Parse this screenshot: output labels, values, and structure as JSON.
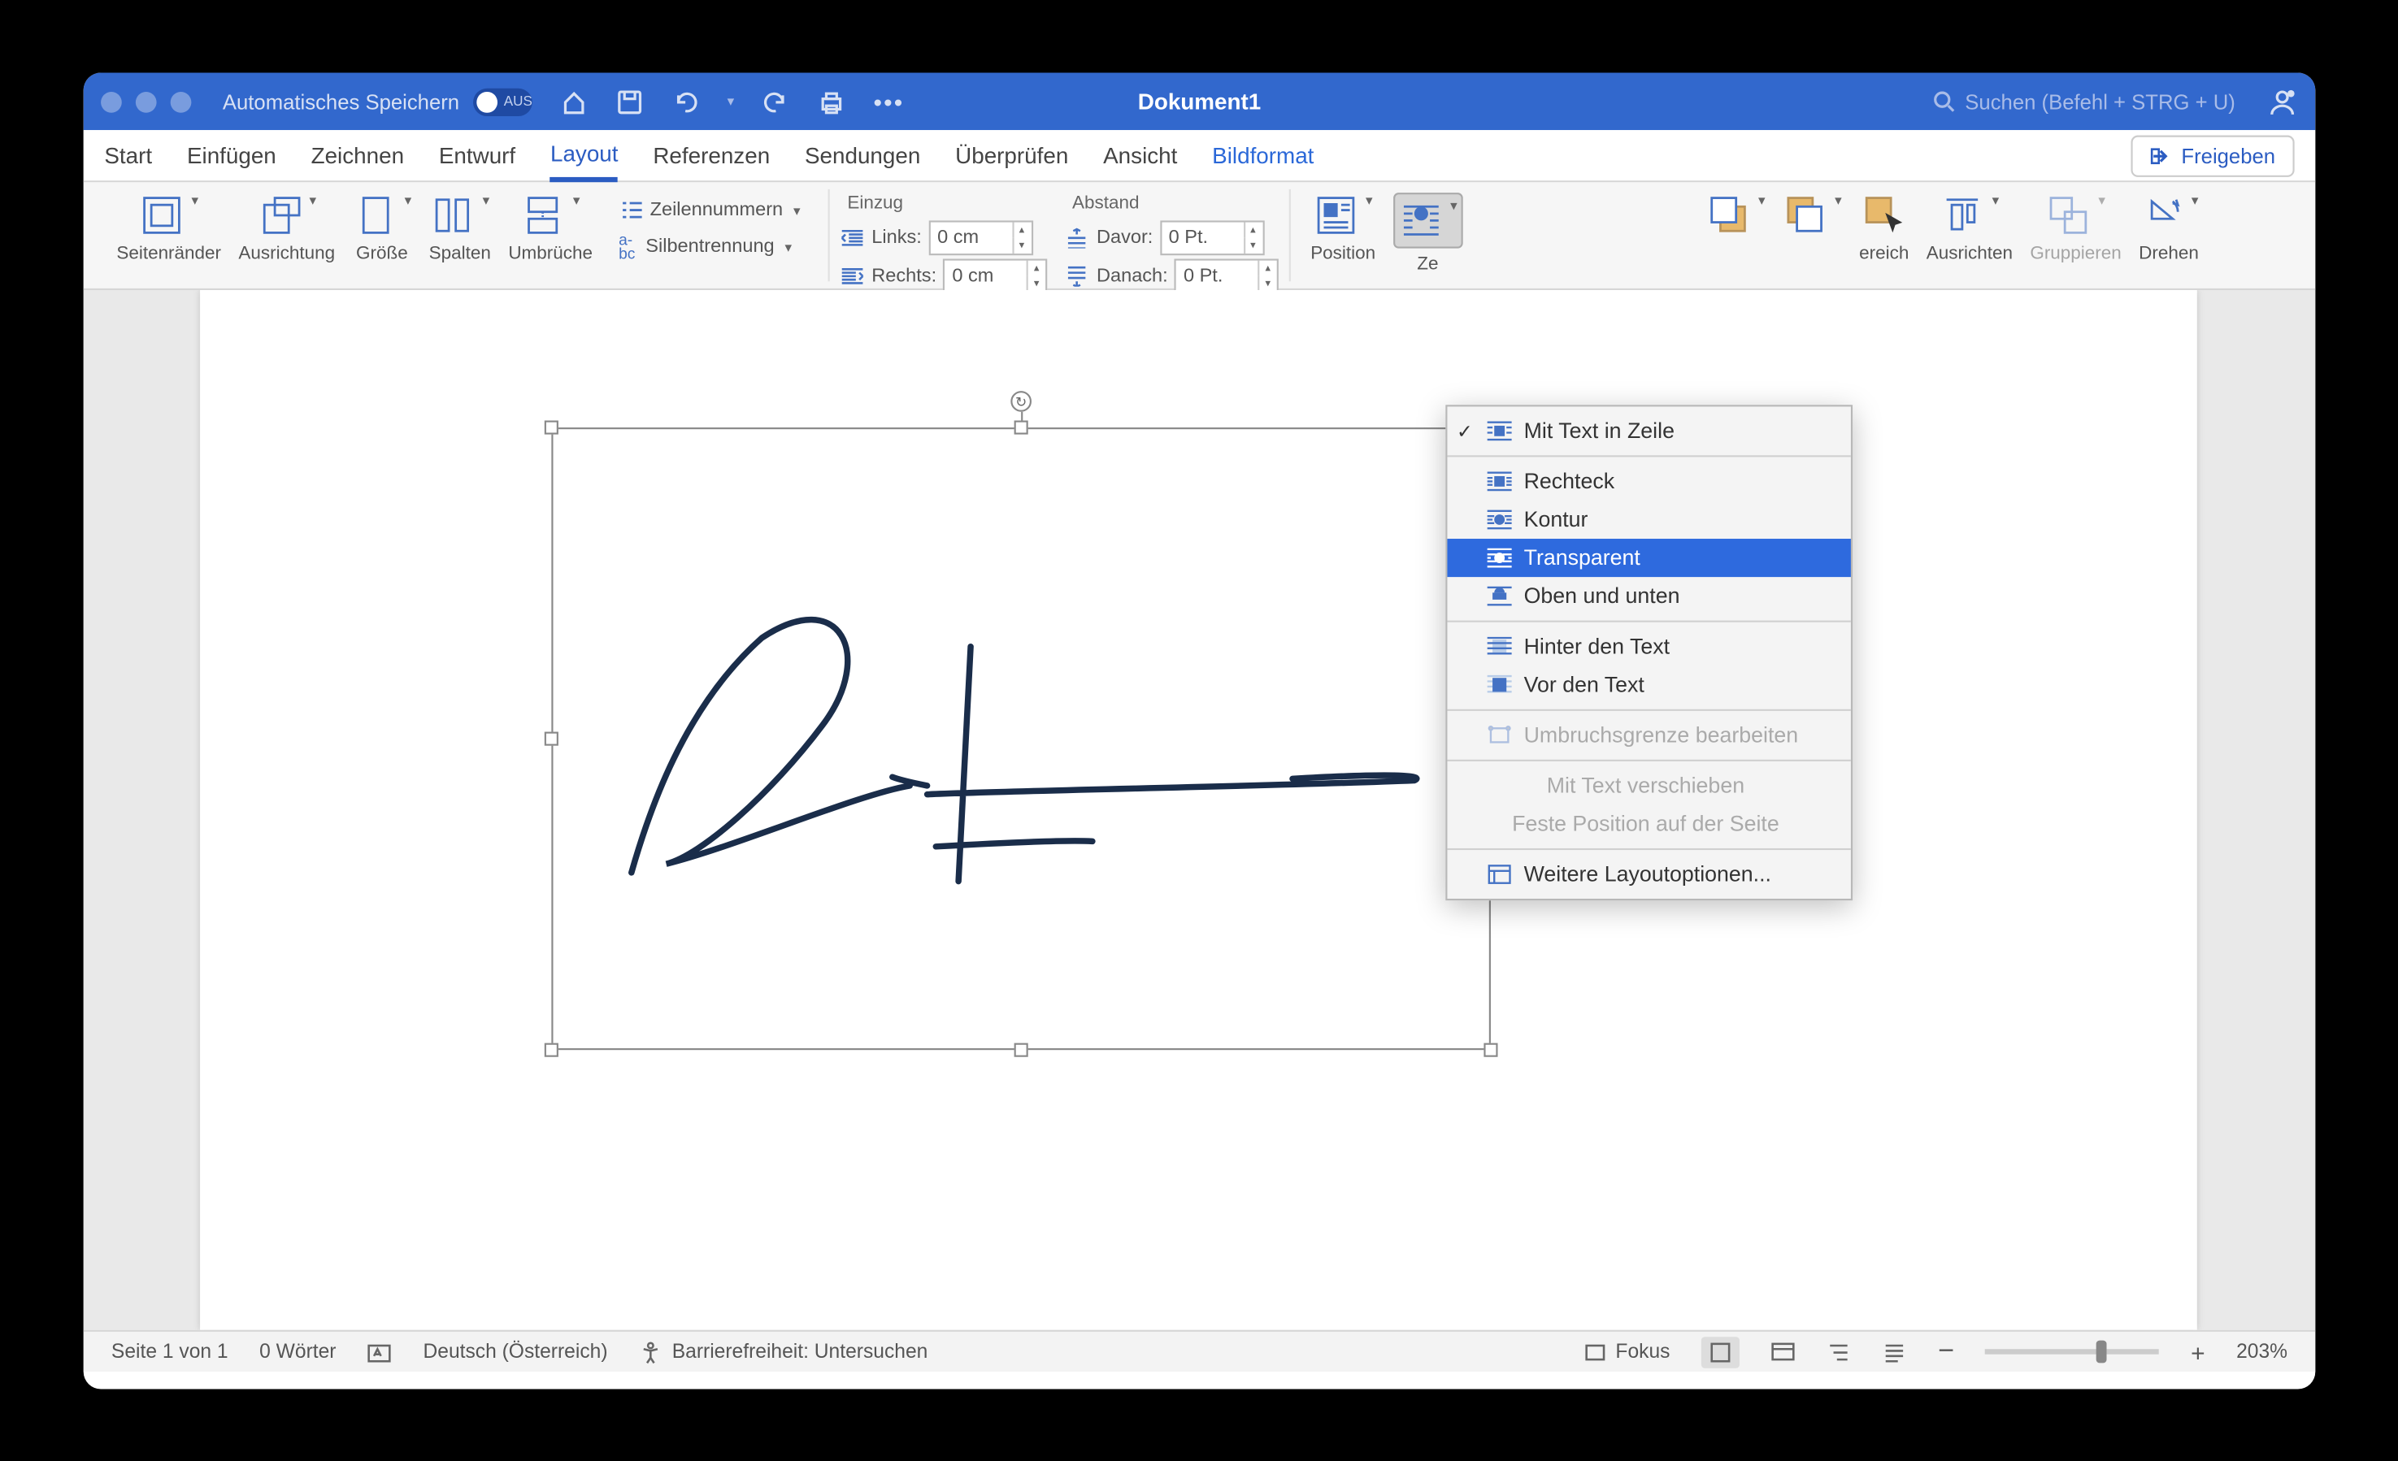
{
  "titlebar": {
    "autosave_label": "Automatisches Speichern",
    "autosave_state": "AUS",
    "document_title": "Dokument1",
    "search_placeholder": "Suchen (Befehl + STRG + U)"
  },
  "tabs": {
    "start": "Start",
    "einfuegen": "Einfügen",
    "zeichnen": "Zeichnen",
    "entwurf": "Entwurf",
    "layout": "Layout",
    "referenzen": "Referenzen",
    "sendungen": "Sendungen",
    "ueberpruefen": "Überprüfen",
    "ansicht": "Ansicht",
    "bildformat": "Bildformat",
    "freigeben": "Freigeben"
  },
  "ribbon": {
    "seitenraender": "Seitenränder",
    "ausrichtung": "Ausrichtung",
    "groesse": "Größe",
    "spalten": "Spalten",
    "umbrueche": "Umbrüche",
    "zeilennummern": "Zeilennummern",
    "silbentrennung": "Silbentrennung",
    "einzug": "Einzug",
    "links": "Links:",
    "rechts": "Rechts:",
    "links_val": "0 cm",
    "rechts_val": "0 cm",
    "abstand": "Abstand",
    "davor": "Davor:",
    "danach": "Danach:",
    "davor_val": "0 Pt.",
    "danach_val": "0 Pt.",
    "position": "Position",
    "ze_partial": "Ze",
    "ereich_partial": "ereich",
    "ausrichten": "Ausrichten",
    "gruppieren": "Gruppieren",
    "drehen": "Drehen"
  },
  "dropdown": {
    "mit_text_in_zeile": "Mit Text in Zeile",
    "rechteck": "Rechteck",
    "kontur": "Kontur",
    "transparent": "Transparent",
    "oben_und_unten": "Oben und unten",
    "hinter_den_text": "Hinter den Text",
    "vor_den_text": "Vor den Text",
    "umbruchsgrenze": "Umbruchsgrenze bearbeiten",
    "mit_text_verschieben": "Mit Text verschieben",
    "feste_position": "Feste Position auf der Seite",
    "weitere_layout": "Weitere Layoutoptionen..."
  },
  "statusbar": {
    "seite": "Seite 1 von 1",
    "woerter": "0 Wörter",
    "sprache": "Deutsch (Österreich)",
    "barrierefreiheit": "Barrierefreiheit: Untersuchen",
    "fokus": "Fokus",
    "zoom": "203%"
  }
}
